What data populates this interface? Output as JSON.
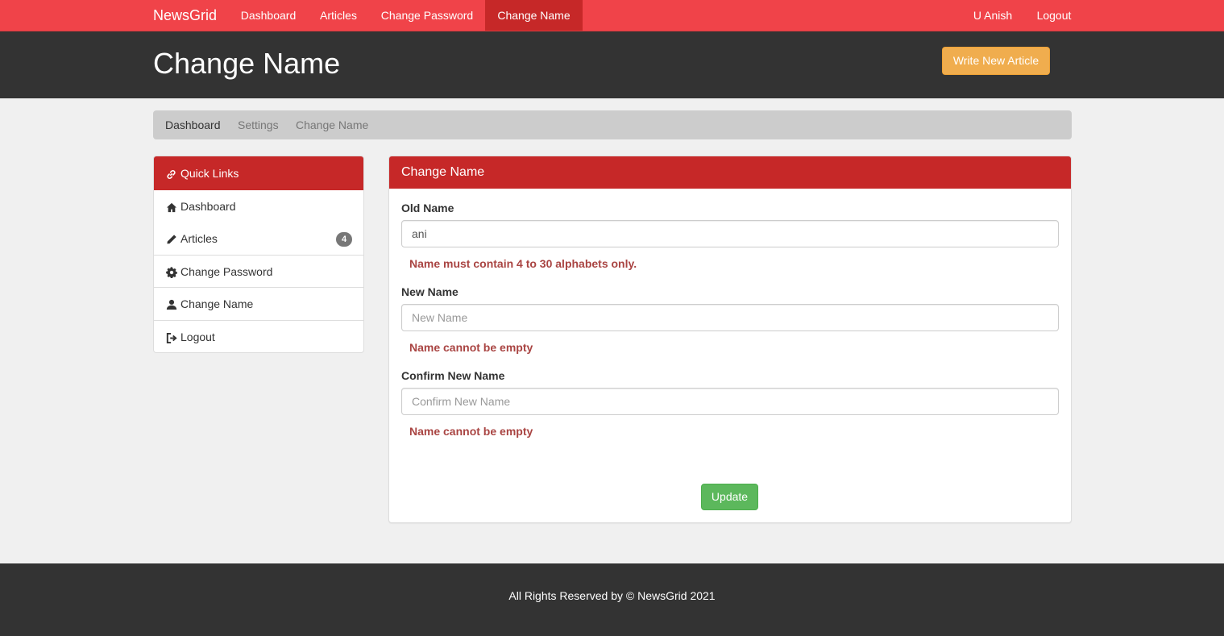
{
  "navbar": {
    "brand": "NewsGrid",
    "links": [
      {
        "label": "Dashboard"
      },
      {
        "label": "Articles"
      },
      {
        "label": "Change Password"
      },
      {
        "label": "Change Name",
        "active": true
      }
    ],
    "user": "U Anish",
    "logout": "Logout"
  },
  "header": {
    "title": "Change Name",
    "write_button": "Write New Article"
  },
  "breadcrumb": [
    "Dashboard",
    "Settings",
    "Change Name"
  ],
  "sidebar": {
    "title": "Quick Links",
    "title_icon": "link-icon",
    "items": [
      {
        "label": "Dashboard",
        "icon": "home-icon"
      },
      {
        "label": "Articles",
        "icon": "pencil-icon",
        "badge": "4"
      },
      {
        "label": "Change Password",
        "icon": "gear-icon"
      },
      {
        "label": "Change Name",
        "icon": "user-icon"
      },
      {
        "label": "Logout",
        "icon": "logout-icon"
      }
    ]
  },
  "form": {
    "title": "Change Name",
    "old_name": {
      "label": "Old Name",
      "value": "ani",
      "error": "Name must contain 4 to 30 alphabets only."
    },
    "new_name": {
      "label": "New Name",
      "placeholder": "New Name",
      "value": "",
      "error": "Name cannot be empty"
    },
    "confirm_name": {
      "label": "Confirm New Name",
      "placeholder": "Confirm New Name",
      "value": "",
      "error": "Name cannot be empty"
    },
    "submit": "Update"
  },
  "footer": {
    "text": "All Rights Reserved by © NewsGrid 2021"
  },
  "colors": {
    "navbar": "#f04349",
    "accent": "#c62828",
    "header": "#333333",
    "warning_button": "#f0ad4e",
    "success_button": "#5cb85c",
    "error_text": "#a94442"
  }
}
